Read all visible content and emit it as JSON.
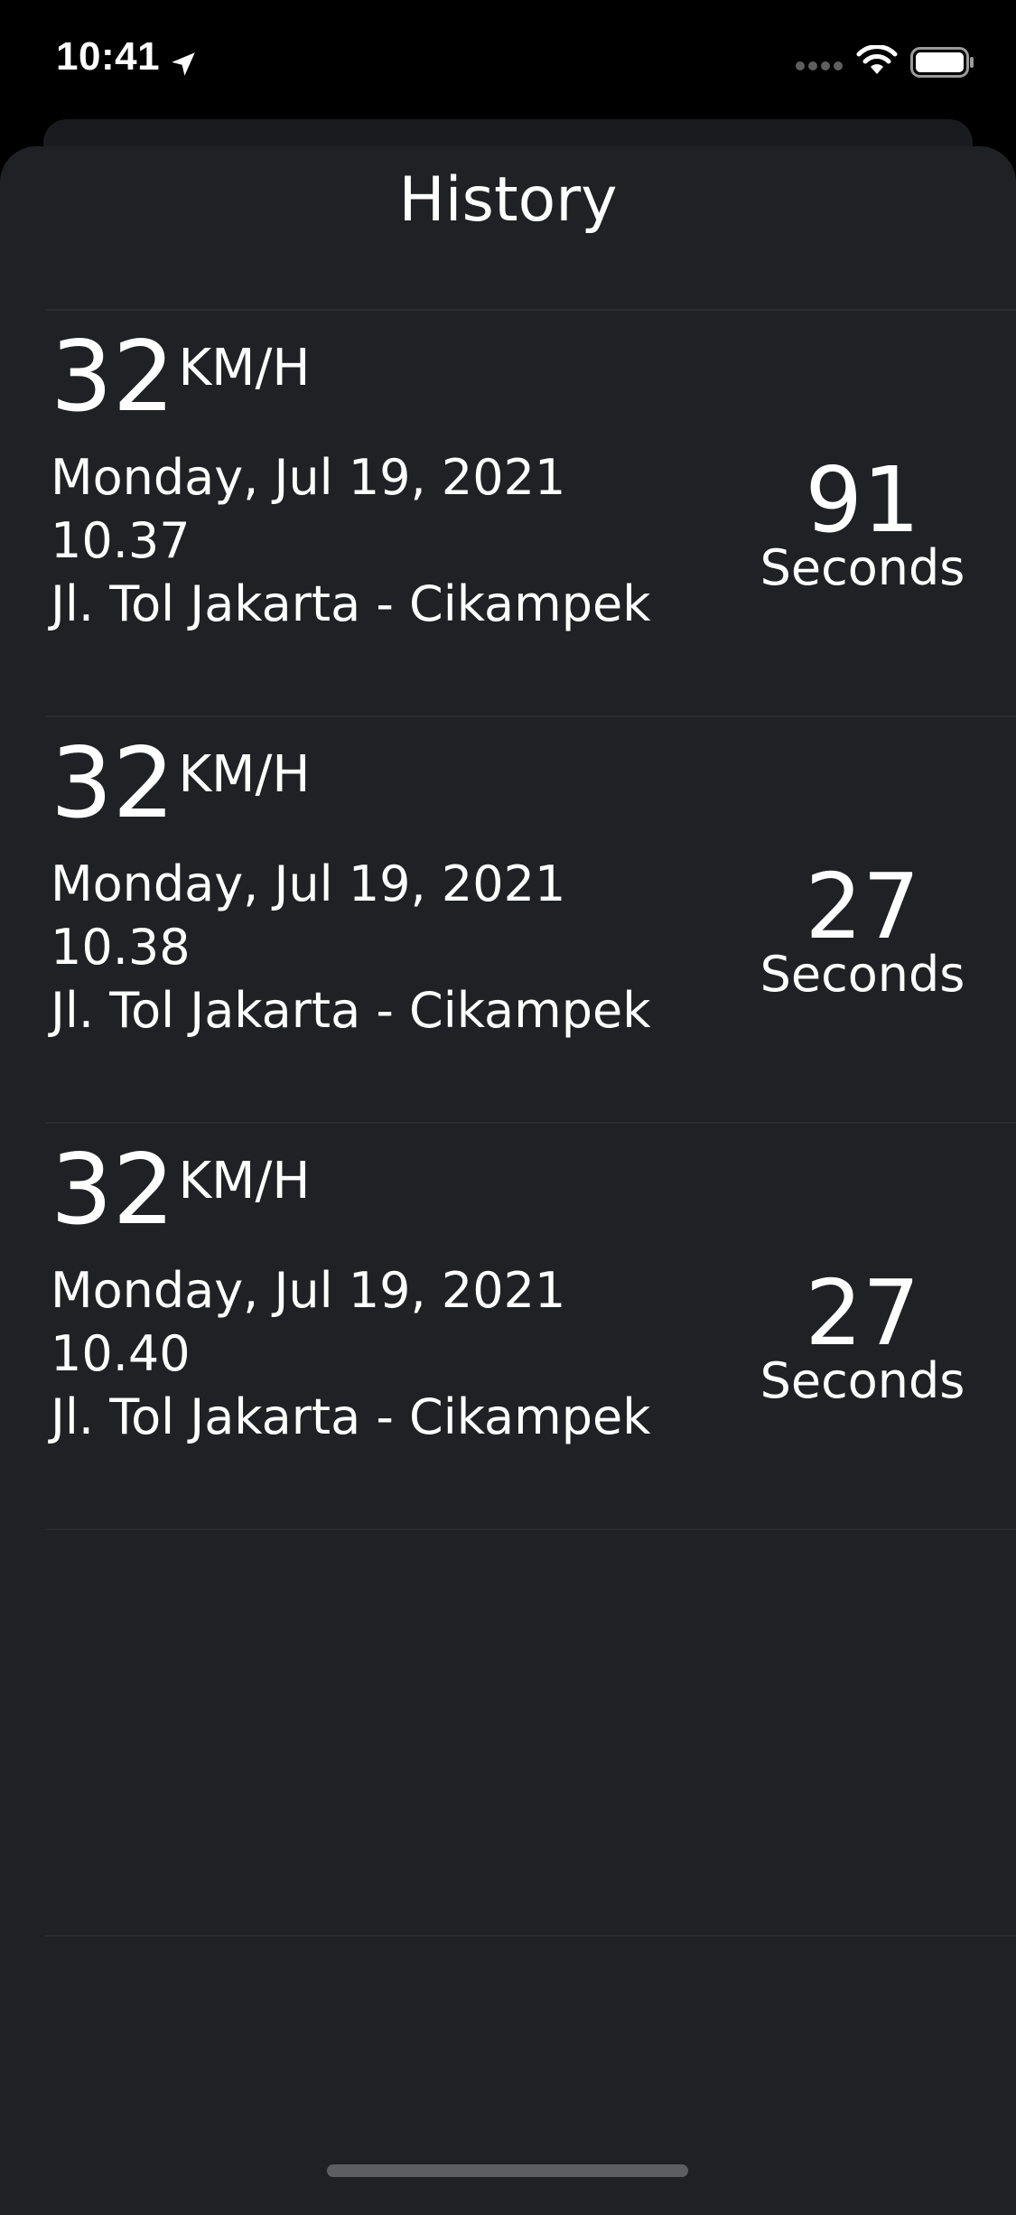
{
  "status_bar": {
    "time": "10:41"
  },
  "screen": {
    "title": "History"
  },
  "history": [
    {
      "speed": "32",
      "unit": "KM/H",
      "date": "Monday, Jul 19, 2021",
      "time": "10.37",
      "location": "Jl. Tol Jakarta - Cikampek",
      "duration": "91",
      "duration_unit": "Seconds"
    },
    {
      "speed": "32",
      "unit": "KM/H",
      "date": "Monday, Jul 19, 2021",
      "time": "10.38",
      "location": "Jl. Tol Jakarta - Cikampek",
      "duration": "27",
      "duration_unit": "Seconds"
    },
    {
      "speed": "32",
      "unit": "KM/H",
      "date": "Monday, Jul 19, 2021",
      "time": "10.40",
      "location": "Jl. Tol Jakarta - Cikampek",
      "duration": "27",
      "duration_unit": "Seconds"
    }
  ],
  "icons": {
    "location": "location-arrow-icon",
    "signal": "cellular-signal-icon",
    "wifi": "wifi-icon",
    "battery": "battery-icon"
  },
  "colors": {
    "background": "#000000",
    "sheet": "#202124",
    "text": "#ffffff"
  }
}
